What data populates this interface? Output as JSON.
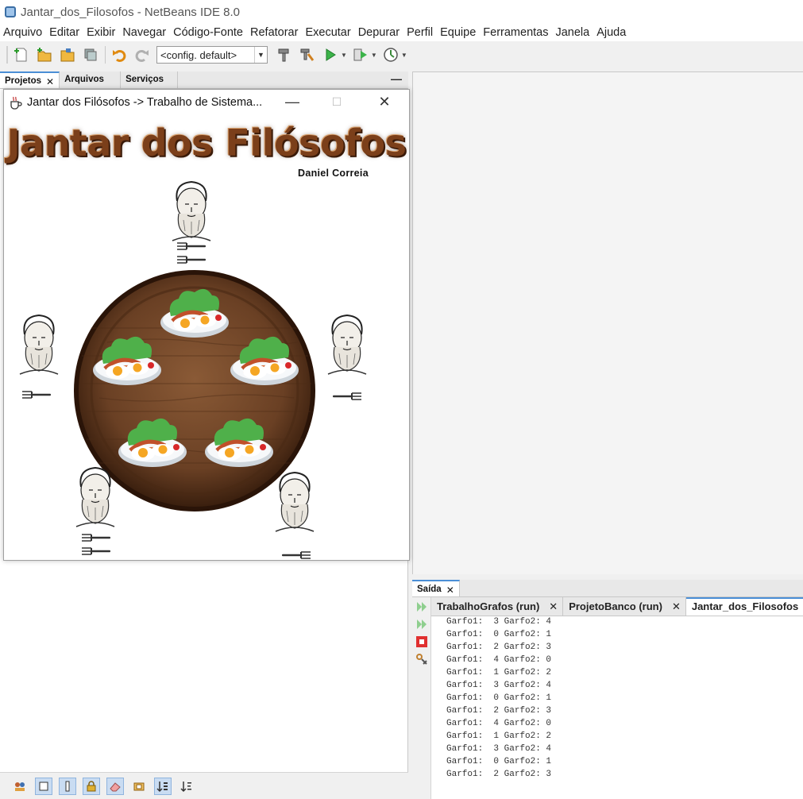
{
  "window": {
    "title": "Jantar_dos_Filosofos - NetBeans IDE 8.0"
  },
  "menu": [
    "Arquivo",
    "Editar",
    "Exibir",
    "Navegar",
    "Código-Fonte",
    "Refatorar",
    "Executar",
    "Depurar",
    "Perfil",
    "Equipe",
    "Ferramentas",
    "Janela",
    "Ajuda"
  ],
  "toolbar": {
    "config": "<config. default>"
  },
  "panel": {
    "tabs": [
      "Projetos",
      "Arquivos",
      "Serviços"
    ]
  },
  "app": {
    "title": "Jantar dos Filósofos -> Trabalho de Sistema...",
    "heading": "Jantar dos Filósofos",
    "author": "Daniel Correia"
  },
  "output": {
    "panel_label": "Saída",
    "tabs": [
      "TrabalhoGrafos (run)",
      "ProjetoBanco (run)",
      "Jantar_dos_Filosofos"
    ],
    "lines": [
      "Garfo1:  3 Garfo2: 4",
      "Garfo1:  0 Garfo2: 1",
      "Garfo1:  2 Garfo2: 3",
      "Garfo1:  4 Garfo2: 0",
      "Garfo1:  1 Garfo2: 2",
      "Garfo1:  3 Garfo2: 4",
      "Garfo1:  0 Garfo2: 1",
      "Garfo1:  2 Garfo2: 3",
      "Garfo1:  4 Garfo2: 0",
      "Garfo1:  1 Garfo2: 2",
      "Garfo1:  3 Garfo2: 4",
      "Garfo1:  0 Garfo2: 1",
      "Garfo1:  2 Garfo2: 3"
    ]
  }
}
